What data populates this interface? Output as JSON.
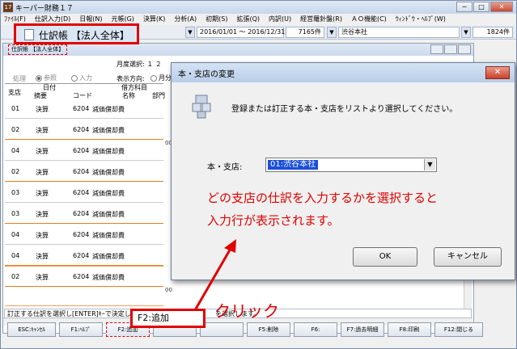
{
  "app": {
    "icon_text": "17",
    "title": "キーパー財務１７",
    "window_buttons": [
      "─",
      "□",
      "✕"
    ],
    "menu": [
      "ﾌｧｲﾙ(F)",
      "仕訳入力(D)",
      "日報(N)",
      "元帳(G)",
      "決算(K)",
      "分析(A)",
      "初期(S)",
      "拡張(Q)",
      "内訳(U)",
      "経営羅針盤(R)",
      "ＡＯ機能(C)",
      "ｳｨﾝﾄﾞｳ・ﾍﾙﾌﾟ(W)"
    ]
  },
  "toolbar": {
    "period": "2016/01/01 ～ 2016/12/31",
    "count": "7165件",
    "branch": "渋谷本社",
    "right_count": "1824件"
  },
  "journal_callout": {
    "text": "仕訳帳 【法人全体】"
  },
  "child_window": {
    "title": "仕訳帳 【法人全体】",
    "month_label": "月度選択:",
    "month_values": "１ ２",
    "process_label": "処理",
    "mode_options": [
      "参照",
      "入力"
    ],
    "direction_label": "表示方向:",
    "direction_value": "月分",
    "headers": {
      "branch": "支店",
      "date": "日付",
      "summary": "摘要",
      "debit": "借方科目",
      "code": "コード",
      "name": "名称",
      "dept": "部門"
    },
    "rows": [
      {
        "branch": "01",
        "date": "決算",
        "code": "6204",
        "name": "減価償却費"
      },
      {
        "branch": "02",
        "date": "決算",
        "code": "6204",
        "name": "減価償却費"
      },
      {
        "branch": "04",
        "date": "決算",
        "code": "6204",
        "name": "減価償却費"
      },
      {
        "branch": "02",
        "date": "決算",
        "code": "6204",
        "name": "減価償却費"
      },
      {
        "branch": "03",
        "date": "決算",
        "code": "6204",
        "name": "減価償却費"
      },
      {
        "branch": "03",
        "date": "決算",
        "code": "6204",
        "name": "減価償却費"
      },
      {
        "branch": "04",
        "date": "決算",
        "code": "6204",
        "name": "減価償却費"
      },
      {
        "branch": "04",
        "date": "決算",
        "code": "6204",
        "name": "減価償却費"
      },
      {
        "branch": "02",
        "date": "決算",
        "code": "6204",
        "name": "減価償却費"
      }
    ],
    "code_marker": "00"
  },
  "status": {
    "left": "訂正する仕訳を選択し[ENTER]ｷｰで決定します。",
    "right": "を選択します。"
  },
  "fkeys": [
    "ESC:ｷｬﾝｾﾙ",
    "F1:ﾍﾙﾌﾟ",
    "F2:追加",
    "",
    "",
    "F5:削除",
    "F6:",
    "F7:過去明細",
    "F8:印刷",
    "F12:閉じる"
  ],
  "f2_callout": "F2:追加",
  "click_label": "クリック",
  "dialog": {
    "title": "本・支店の変更",
    "close": "✕",
    "message": "登録または訂正する本・支店をリストより選択してください。",
    "branch_label": "本・支店:",
    "branch_value": "01:渋谷本社",
    "annotation_line1": "どの支店の仕訳を入力するかを選択すると",
    "annotation_line2": "入力行が表示されます。",
    "ok": "OK",
    "cancel": "キャンセル"
  }
}
